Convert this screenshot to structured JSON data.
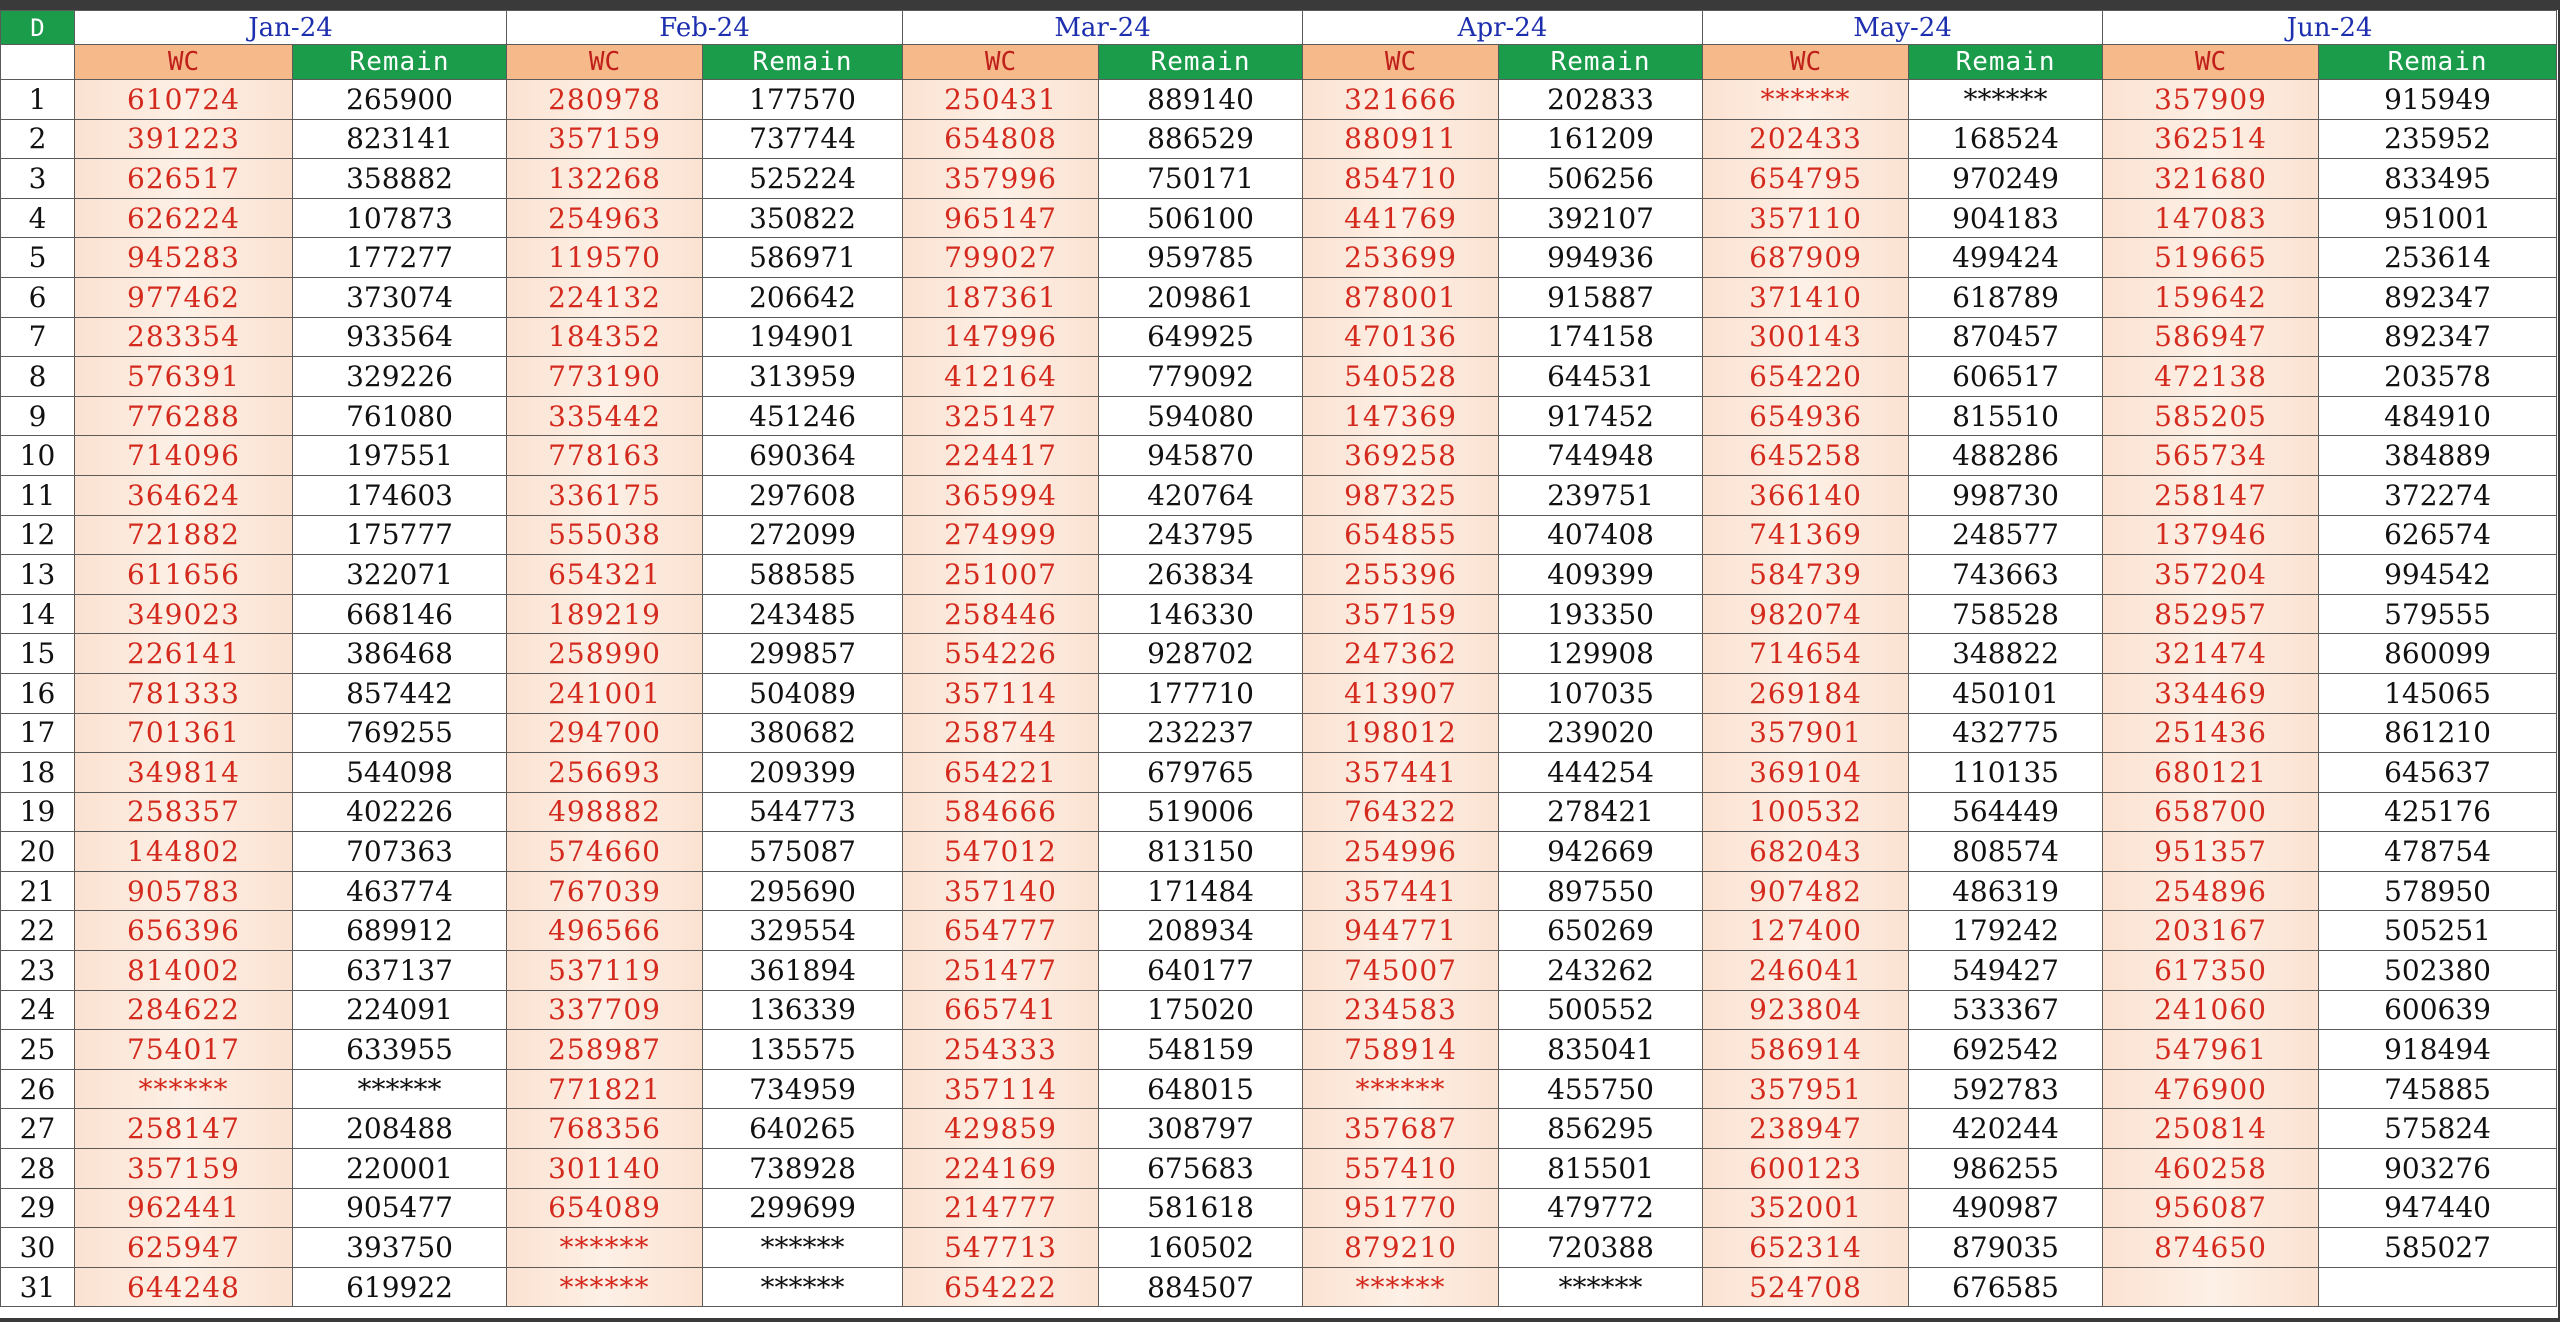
{
  "corner_label": "D",
  "sub_headers": {
    "wc": "WC",
    "rem": "Remain"
  },
  "months": [
    "Jan-24",
    "Feb-24",
    "Mar-24",
    "Apr-24",
    "May-24",
    "Jun-24"
  ],
  "rows": [
    {
      "day": "1",
      "cells": [
        "610724",
        "265900",
        "280978",
        "177570",
        "250431",
        "889140",
        "321666",
        "202833",
        "******",
        "******",
        "357909",
        "915949"
      ]
    },
    {
      "day": "2",
      "cells": [
        "391223",
        "823141",
        "357159",
        "737744",
        "654808",
        "886529",
        "880911",
        "161209",
        "202433",
        "168524",
        "362514",
        "235952"
      ]
    },
    {
      "day": "3",
      "cells": [
        "626517",
        "358882",
        "132268",
        "525224",
        "357996",
        "750171",
        "854710",
        "506256",
        "654795",
        "970249",
        "321680",
        "833495"
      ]
    },
    {
      "day": "4",
      "cells": [
        "626224",
        "107873",
        "254963",
        "350822",
        "965147",
        "506100",
        "441769",
        "392107",
        "357110",
        "904183",
        "147083",
        "951001"
      ]
    },
    {
      "day": "5",
      "cells": [
        "945283",
        "177277",
        "119570",
        "586971",
        "799027",
        "959785",
        "253699",
        "994936",
        "687909",
        "499424",
        "519665",
        "253614"
      ]
    },
    {
      "day": "6",
      "cells": [
        "977462",
        "373074",
        "224132",
        "206642",
        "187361",
        "209861",
        "878001",
        "915887",
        "371410",
        "618789",
        "159642",
        "892347"
      ]
    },
    {
      "day": "7",
      "cells": [
        "283354",
        "933564",
        "184352",
        "194901",
        "147996",
        "649925",
        "470136",
        "174158",
        "300143",
        "870457",
        "586947",
        "892347"
      ]
    },
    {
      "day": "8",
      "cells": [
        "576391",
        "329226",
        "773190",
        "313959",
        "412164",
        "779092",
        "540528",
        "644531",
        "654220",
        "606517",
        "472138",
        "203578"
      ]
    },
    {
      "day": "9",
      "cells": [
        "776288",
        "761080",
        "335442",
        "451246",
        "325147",
        "594080",
        "147369",
        "917452",
        "654936",
        "815510",
        "585205",
        "484910"
      ]
    },
    {
      "day": "10",
      "cells": [
        "714096",
        "197551",
        "778163",
        "690364",
        "224417",
        "945870",
        "369258",
        "744948",
        "645258",
        "488286",
        "565734",
        "384889"
      ]
    },
    {
      "day": "11",
      "cells": [
        "364624",
        "174603",
        "336175",
        "297608",
        "365994",
        "420764",
        "987325",
        "239751",
        "366140",
        "998730",
        "258147",
        "372274"
      ]
    },
    {
      "day": "12",
      "cells": [
        "721882",
        "175777",
        "555038",
        "272099",
        "274999",
        "243795",
        "654855",
        "407408",
        "741369",
        "248577",
        "137946",
        "626574"
      ]
    },
    {
      "day": "13",
      "cells": [
        "611656",
        "322071",
        "654321",
        "588585",
        "251007",
        "263834",
        "255396",
        "409399",
        "584739",
        "743663",
        "357204",
        "994542"
      ]
    },
    {
      "day": "14",
      "cells": [
        "349023",
        "668146",
        "189219",
        "243485",
        "258446",
        "146330",
        "357159",
        "193350",
        "982074",
        "758528",
        "852957",
        "579555"
      ]
    },
    {
      "day": "15",
      "cells": [
        "226141",
        "386468",
        "258990",
        "299857",
        "554226",
        "928702",
        "247362",
        "129908",
        "714654",
        "348822",
        "321474",
        "860099"
      ]
    },
    {
      "day": "16",
      "cells": [
        "781333",
        "857442",
        "241001",
        "504089",
        "357114",
        "177710",
        "413907",
        "107035",
        "269184",
        "450101",
        "334469",
        "145065"
      ]
    },
    {
      "day": "17",
      "cells": [
        "701361",
        "769255",
        "294700",
        "380682",
        "258744",
        "232237",
        "198012",
        "239020",
        "357901",
        "432775",
        "251436",
        "861210"
      ]
    },
    {
      "day": "18",
      "cells": [
        "349814",
        "544098",
        "256693",
        "209399",
        "654221",
        "679765",
        "357441",
        "444254",
        "369104",
        "110135",
        "680121",
        "645637"
      ]
    },
    {
      "day": "19",
      "cells": [
        "258357",
        "402226",
        "498882",
        "544773",
        "584666",
        "519006",
        "764322",
        "278421",
        "100532",
        "564449",
        "658700",
        "425176"
      ]
    },
    {
      "day": "20",
      "cells": [
        "144802",
        "707363",
        "574660",
        "575087",
        "547012",
        "813150",
        "254996",
        "942669",
        "682043",
        "808574",
        "951357",
        "478754"
      ]
    },
    {
      "day": "21",
      "cells": [
        "905783",
        "463774",
        "767039",
        "295690",
        "357140",
        "171484",
        "357441",
        "897550",
        "907482",
        "486319",
        "254896",
        "578950"
      ]
    },
    {
      "day": "22",
      "cells": [
        "656396",
        "689912",
        "496566",
        "329554",
        "654777",
        "208934",
        "944771",
        "650269",
        "127400",
        "179242",
        "203167",
        "505251"
      ]
    },
    {
      "day": "23",
      "cells": [
        "814002",
        "637137",
        "537119",
        "361894",
        "251477",
        "640177",
        "745007",
        "243262",
        "246041",
        "549427",
        "617350",
        "502380"
      ]
    },
    {
      "day": "24",
      "cells": [
        "284622",
        "224091",
        "337709",
        "136339",
        "665741",
        "175020",
        "234583",
        "500552",
        "923804",
        "533367",
        "241060",
        "600639"
      ]
    },
    {
      "day": "25",
      "cells": [
        "754017",
        "633955",
        "258987",
        "135575",
        "254333",
        "548159",
        "758914",
        "835041",
        "586914",
        "692542",
        "547961",
        "918494"
      ]
    },
    {
      "day": "26",
      "cells": [
        "******",
        "******",
        "771821",
        "734959",
        "357114",
        "648015",
        "******",
        "455750",
        "357951",
        "592783",
        "476900",
        "745885"
      ]
    },
    {
      "day": "27",
      "cells": [
        "258147",
        "208488",
        "768356",
        "640265",
        "429859",
        "308797",
        "357687",
        "856295",
        "238947",
        "420244",
        "250814",
        "575824"
      ]
    },
    {
      "day": "28",
      "cells": [
        "357159",
        "220001",
        "301140",
        "738928",
        "224169",
        "675683",
        "557410",
        "815501",
        "600123",
        "986255",
        "460258",
        "903276"
      ]
    },
    {
      "day": "29",
      "cells": [
        "962441",
        "905477",
        "654089",
        "299699",
        "214777",
        "581618",
        "951770",
        "479772",
        "352001",
        "490987",
        "956087",
        "947440"
      ]
    },
    {
      "day": "30",
      "cells": [
        "625947",
        "393750",
        "******",
        "******",
        "547713",
        "160502",
        "879210",
        "720388",
        "652314",
        "879035",
        "874650",
        "585027"
      ]
    },
    {
      "day": "31",
      "cells": [
        "644248",
        "619922",
        "******",
        "******",
        "654222",
        "884507",
        "******",
        "******",
        "524708",
        "676585",
        "",
        ""
      ]
    }
  ]
}
